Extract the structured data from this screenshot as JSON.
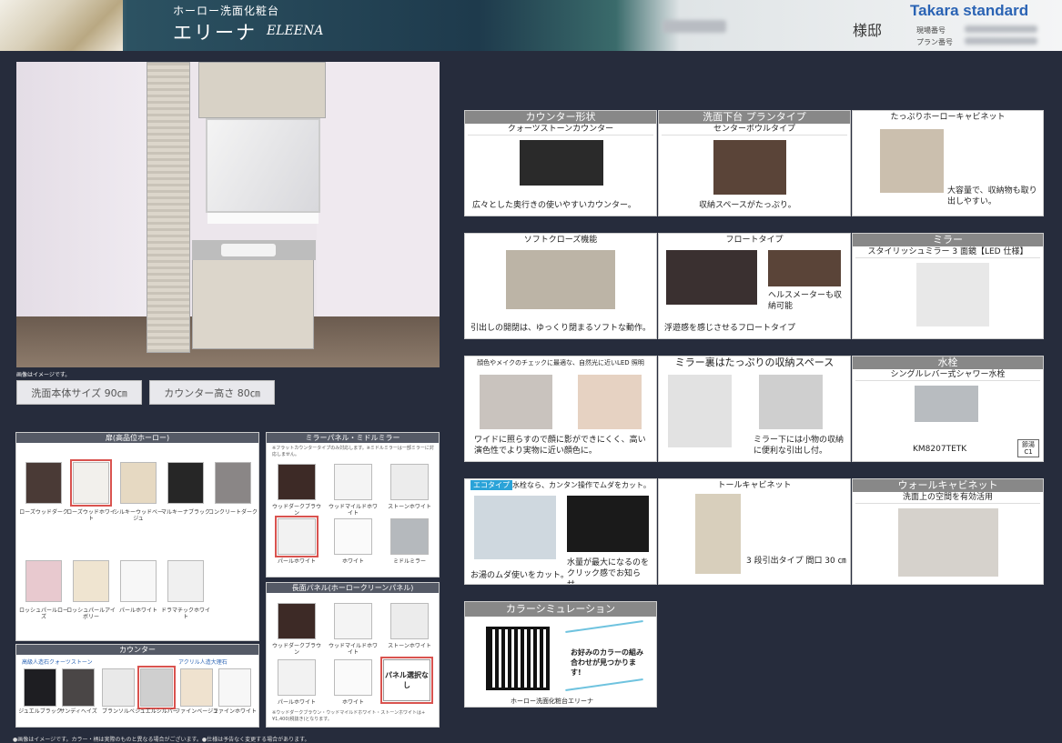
{
  "header": {
    "subtitle": "ホーロー洗面化粧台",
    "title_jp": "エリーナ",
    "title_en": "ELEENA",
    "sama": "様邸",
    "logo": "Takara standard",
    "genba_label": "現場番号",
    "plan_label": "プラン番号"
  },
  "room": {
    "note": "画像はイメージです。"
  },
  "size_buttons": {
    "body_size": "洗面本体サイズ 90㎝",
    "counter_height": "カウンター高さ 80㎝"
  },
  "features": [
    {
      "head": "カウンター形状",
      "sub": "クォーツストーンカウンター",
      "text": "広々とした奥行きの使いやすいカウンター。"
    },
    {
      "head": "洗面下台 プランタイプ",
      "sub": "センターボウルタイプ",
      "text": "収納スペースがたっぷり。"
    },
    {
      "head": "たっぷりホーローキャビネット",
      "sub": "",
      "text": "大容量で、収納物も取り出しやすい。"
    },
    {
      "head": "ソフトクローズ機能",
      "sub": "",
      "text": "引出しの開閉は、ゆっくり閉まるソフトな動作。"
    },
    {
      "head": "フロートタイプ",
      "sub": "",
      "text": "浮遊感を感じさせるフロートタイプ",
      "text2": "ヘルスメーターも収納可能"
    },
    {
      "head": "ミラー",
      "sub": "スタイリッシュミラー 3 面鏡【LED 仕様】",
      "text": ""
    },
    {
      "head": "顔色やメイクのチェックに最適な、自然光に近いLED 照明",
      "sub": "",
      "text": "ワイドに照らすので顔に影ができにくく、高い演色性でより実物に近い顔色に。",
      "tag": "高演色タイプ LED"
    },
    {
      "head": "ミラー裏はたっぷりの収納スペース",
      "sub": "",
      "text": "ミラー下には小物の収納に便利な引出し付。"
    },
    {
      "head": "水栓",
      "sub": "シングルレバー式シャワー水栓",
      "text": "KM8207TETK",
      "badge": "節湯C1"
    },
    {
      "head": "水栓なら、カンタン操作でムダをカット。",
      "tag": "エコタイプ",
      "sub": "",
      "text": "お湯のムダ使いをカット。",
      "text2": "水量が最大になるのをクリック感でお知らせ。"
    },
    {
      "head": "トールキャビネット",
      "sub": "",
      "text": "3 段引出タイプ 間口 30 ㎝"
    },
    {
      "head": "ウォールキャビネット",
      "sub": "洗面上の空間を有効活用",
      "text": ""
    }
  ],
  "color_sim": {
    "head": "カラーシミュレーション",
    "text": "お好みのカラーの組み合わせが見つかります!",
    "caption": "ホーロー洗面化粧台エリーナ"
  },
  "door": {
    "head": "扉(高品位ホーロー)",
    "items": [
      {
        "label": "ローズウッドダーク",
        "color": "#4a3a36"
      },
      {
        "label": "ローズウッドホワイト",
        "color": "#f2f0ec",
        "selected": true
      },
      {
        "label": "シルキーウッドベージュ",
        "color": "#e6d9c2"
      },
      {
        "label": "マルキーナブラック",
        "color": "#262626"
      },
      {
        "label": "コンクリートダーク",
        "color": "#8a8686"
      },
      {
        "label": "ロッシュパールローズ",
        "color": "#e8c9cf"
      },
      {
        "label": "ロッシュパールアイボリー",
        "color": "#efe4d0"
      },
      {
        "label": "パールホワイト",
        "color": "#f7f7f7"
      },
      {
        "label": "ドラマチックホワイト",
        "color": "#f0f0f0"
      }
    ]
  },
  "counter": {
    "head": "カウンター",
    "sub1": "高級人造石クォーツストーン",
    "sub2": "アクリル人造大理石",
    "items": [
      {
        "label": "ジュエルブラック",
        "color": "#1e1e22"
      },
      {
        "label": "サンディヘイズ",
        "color": "#4a4646"
      },
      {
        "label": "ブランソルベ",
        "color": "#e9e9e9"
      },
      {
        "label": "ジュエルシルバー",
        "color": "#cfcfcf",
        "selected": true
      },
      {
        "label": "ファインベージュ",
        "color": "#efe2cf"
      },
      {
        "label": "ファインホワイト",
        "color": "#f7f7f7"
      }
    ]
  },
  "mirror_panel": {
    "head": "ミラーパネル・ミドルミラー",
    "note": "※フラットカウンタータイプのみ対応します。※ミドルミラーは一部ミラーに対応しません。",
    "items": [
      {
        "label": "ウッドダークブラウン",
        "color": "#3d2a26"
      },
      {
        "label": "ウッドマイルドホワイト",
        "color": "#f4f4f4"
      },
      {
        "label": "ストーンホワイト",
        "color": "#ececec"
      },
      {
        "label": "パールホワイト",
        "color": "#f2f2f2",
        "selected": true
      },
      {
        "label": "ホワイト",
        "color": "#fafafa"
      },
      {
        "label": "ミドルミラー",
        "color": "#b5b9bd"
      }
    ]
  },
  "side_panel": {
    "head": "長面パネル(ホーロークリーンパネル)",
    "note": "※ウッドダークブラウン・ウッドマイルドホワイト・ストーンホワイトは+¥1,400(税抜き)となります。",
    "none_label": "パネル選択なし",
    "items": [
      {
        "label": "ウッドダークブラウン",
        "color": "#3d2a26"
      },
      {
        "label": "ウッドマイルドホワイト",
        "color": "#f4f4f4"
      },
      {
        "label": "ストーンホワイト",
        "color": "#ececec"
      },
      {
        "label": "パールホワイト",
        "color": "#f2f2f2"
      },
      {
        "label": "ホワイト",
        "color": "#fafafa"
      }
    ]
  },
  "footer": "●画像はイメージです。カラー・柄は実際のものと異なる場合がございます。●仕様は予告なく変更する場合があります。"
}
